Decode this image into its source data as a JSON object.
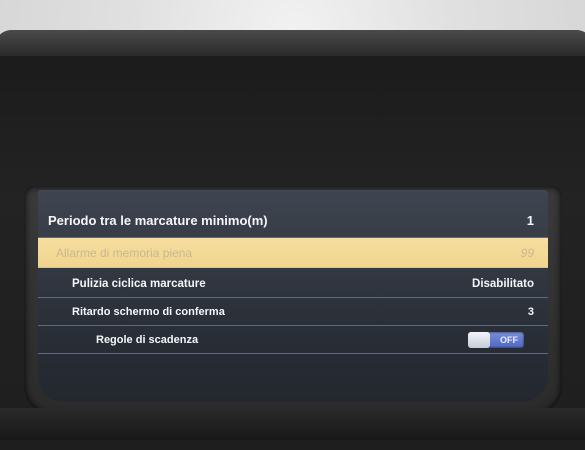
{
  "screen": {
    "title": "",
    "rows": [
      {
        "label": "Periodo tra le marcature minimo(m)",
        "value": "1"
      },
      {
        "label": "Allarme di memoria piena",
        "value": "99"
      },
      {
        "label": "Pulizia ciclica marcature",
        "value": "Disabilitato"
      },
      {
        "label": "Ritardo schermo di conferma",
        "value": "3"
      },
      {
        "label": "Regole di scadenza",
        "value": "OFF"
      }
    ],
    "selected_row": 1
  },
  "colors": {
    "selected_row_bg": "#f2d896",
    "row_text": "#f4f6fa",
    "toggle_bg": "#5a70c8"
  },
  "icons": {
    "toggle": "toggle-switch-icon"
  }
}
